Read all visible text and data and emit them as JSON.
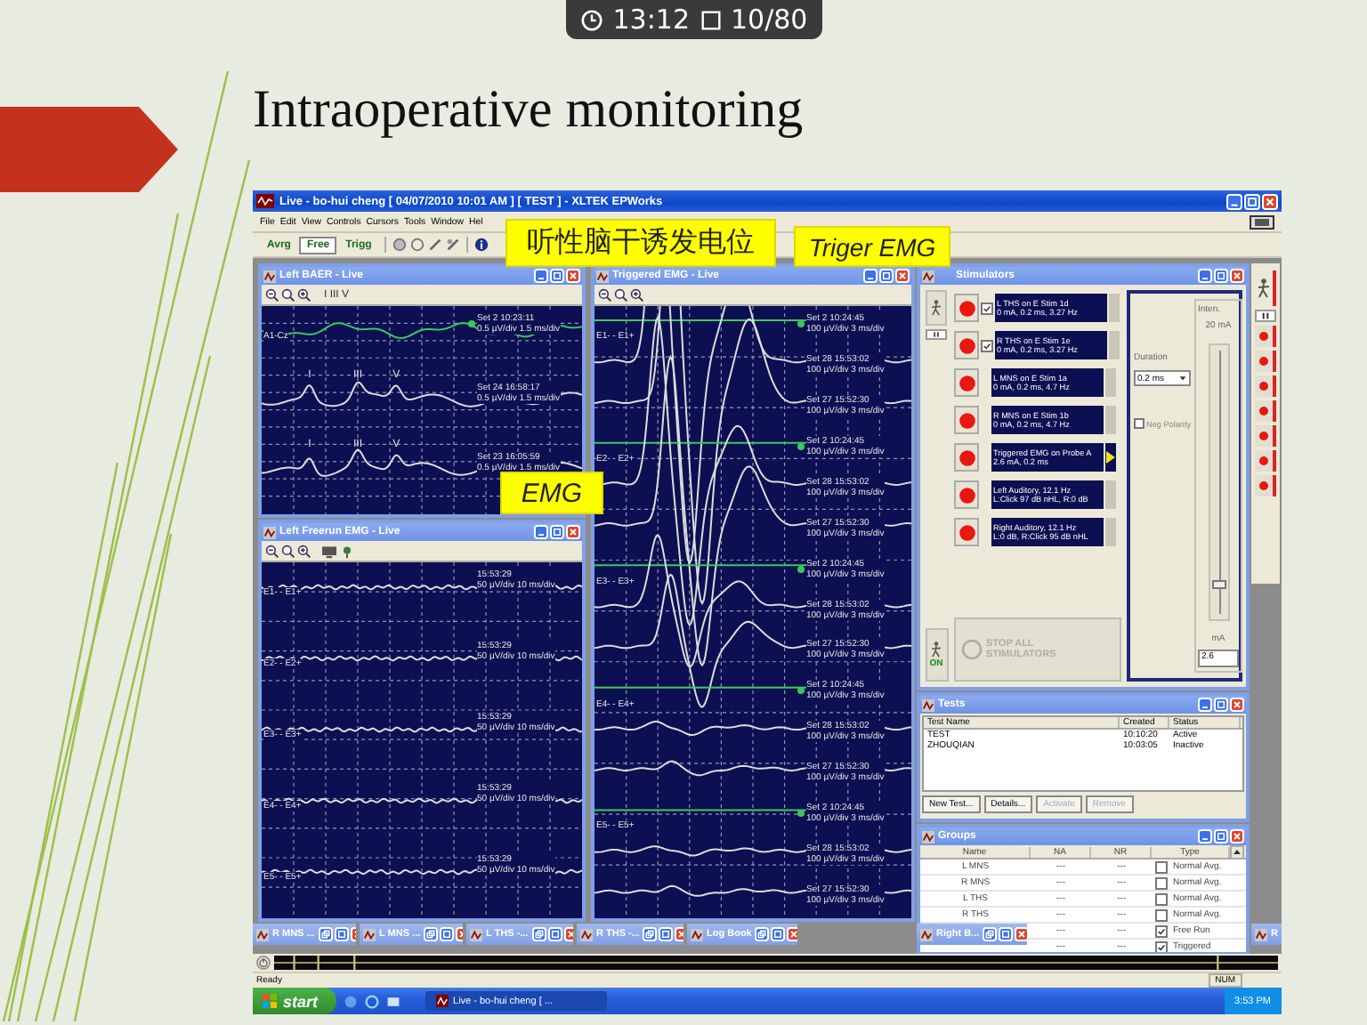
{
  "viewer": {
    "time": "13:12",
    "page": "10/80"
  },
  "slide": {
    "title": "Intraoperative monitoring",
    "callouts": [
      {
        "text": "听性脑干诱发电位"
      },
      {
        "text": "Triger EMG"
      },
      {
        "text": "EMG"
      }
    ]
  },
  "app": {
    "title": "Live - bo-hui cheng  [ 04/07/2010 10:01 AM ]  [ TEST ]  - XLTEK EPWorks",
    "menu": [
      "File",
      "Edit",
      "View",
      "Controls",
      "Cursors",
      "Tools",
      "Window",
      "Hel"
    ],
    "modes": [
      {
        "label": "Avrg",
        "selected": false
      },
      {
        "label": "Free",
        "selected": true
      },
      {
        "label": "Trigg",
        "selected": false
      }
    ],
    "windows": [
      {
        "kind": "baer",
        "title": "Left BAER - Live",
        "marks": "I  III  V",
        "channels": [
          {
            "label": "A1-Cz",
            "sweeps": [
              {
                "set": "Set 2 10:23:11",
                "scale": "0.5 µV/div 1.5 ms/div",
                "marker": true
              },
              {
                "set": "Set 24 16:58:17",
                "scale": "0.5 µV/div 1.5 ms/div",
                "marker": false,
                "peaks": [
                  "I",
                  "III",
                  "V"
                ]
              },
              {
                "set": "Set 23 16:05:59",
                "scale": "0.5 µV/div 1.5 ms/div",
                "marker": false,
                "peaks": [
                  "I",
                  "III",
                  "V"
                ]
              }
            ]
          }
        ]
      },
      {
        "kind": "freerun",
        "title": "Left Freerun EMG - Live",
        "channels": [
          {
            "label": "E1- - E1+",
            "sweeps": [
              {
                "set": "15:53:29",
                "scale": "50 µV/div 10 ms/div",
                "marker": false
              }
            ]
          },
          {
            "label": "E2- - E2+",
            "sweeps": [
              {
                "set": "15:53:29",
                "scale": "50 µV/div 10 ms/div",
                "marker": false
              }
            ]
          },
          {
            "label": "E3- - E3+",
            "sweeps": [
              {
                "set": "15:53:29",
                "scale": "50 µV/div 10 ms/div",
                "marker": false
              }
            ]
          },
          {
            "label": "E4- - E4+",
            "sweeps": [
              {
                "set": "15:53:29",
                "scale": "50 µV/div 10 ms/div",
                "marker": false
              }
            ]
          },
          {
            "label": "E5- - E5+",
            "sweeps": [
              {
                "set": "15:53:29",
                "scale": "50 µV/div 10 ms/div",
                "marker": false
              }
            ]
          }
        ]
      },
      {
        "kind": "triggered",
        "title": "Triggered EMG - Live",
        "channels": [
          {
            "label": "E1- - E1+",
            "sweeps": [
              {
                "set": "Set 2 10:24:45",
                "scale": "100 µV/div 3 ms/div",
                "marker": true
              },
              {
                "set": "Set 28 15:53:02",
                "scale": "100 µV/div 3 ms/div",
                "marker": false
              },
              {
                "set": "Set 27 15:52:30",
                "scale": "100 µV/div 3 ms/div",
                "marker": false
              }
            ]
          },
          {
            "label": "E2- - E2+",
            "sweeps": [
              {
                "set": "Set 2 10:24:45",
                "scale": "100 µV/div 3 ms/div",
                "marker": true
              },
              {
                "set": "Set 28 15:53:02",
                "scale": "100 µV/div 3 ms/div",
                "marker": false
              },
              {
                "set": "Set 27 15:52:30",
                "scale": "100 µV/div 3 ms/div",
                "marker": false
              }
            ]
          },
          {
            "label": "E3- - E3+",
            "sweeps": [
              {
                "set": "Set 2 10:24:45",
                "scale": "100 µV/div 3 ms/div",
                "marker": true
              },
              {
                "set": "Set 28 15:53:02",
                "scale": "100 µV/div 3 ms/div",
                "marker": false
              },
              {
                "set": "Set 27 15:52:30",
                "scale": "100 µV/div 3 ms/div",
                "marker": false
              }
            ]
          },
          {
            "label": "E4- - E4+",
            "sweeps": [
              {
                "set": "Set 2 10:24:45",
                "scale": "100 µV/div 3 ms/div",
                "marker": true
              },
              {
                "set": "Set 28 15:53:02",
                "scale": "100 µV/div 3 ms/div",
                "marker": false
              },
              {
                "set": "Set 27 15:52:30",
                "scale": "100 µV/div 3 ms/div",
                "marker": false
              }
            ]
          },
          {
            "label": "E5- - E5+",
            "sweeps": [
              {
                "set": "Set 2 10:24:45",
                "scale": "100 µV/div 3 ms/div",
                "marker": true
              },
              {
                "set": "Set 28 15:53:02",
                "scale": "100 µV/div 3 ms/div",
                "marker": false
              },
              {
                "set": "Set 27 15:52:30",
                "scale": "100 µV/div 3 ms/div",
                "marker": false
              }
            ]
          }
        ]
      },
      {
        "kind": "stimulators",
        "title": "Stimulators",
        "stimulators": [
          {
            "kind": "checkable",
            "checked": true,
            "selected": false,
            "name": "L THS on E Stim 1d",
            "settings": "0 mA, 0.2 ms, 3.27 Hz"
          },
          {
            "kind": "checkable",
            "checked": true,
            "selected": false,
            "name": "R THS on E Stim 1e",
            "settings": "0 mA, 0.2 ms, 3.27 Hz"
          },
          {
            "kind": "plain",
            "selected": false,
            "name": "L MNS on E Stim 1a",
            "settings": "0 mA, 0.2 ms, 4.7 Hz"
          },
          {
            "kind": "plain",
            "selected": false,
            "name": "R MNS on E Stim 1b",
            "settings": "0 mA, 0.2 ms, 4.7 Hz"
          },
          {
            "kind": "plain",
            "selected": true,
            "name": "Triggered EMG on Probe A",
            "settings": "2.6 mA, 0.2 ms"
          },
          {
            "kind": "plain",
            "selected": false,
            "name": "Left Auditory, 12.1 Hz",
            "settings": "L:Click 97 dB nHL, R:0 dB"
          },
          {
            "kind": "plain",
            "selected": false,
            "name": "Right Auditory, 12.1 Hz",
            "settings": "L:0 dB, R:Click 95 dB nHL"
          }
        ],
        "on": "ON",
        "stop": "STOP ALL STIMULATORS",
        "duration_label": "Duration",
        "duration": "0.2 ms",
        "polarity": {
          "label": "Neg Polarity",
          "checked": false,
          "disabled": true
        },
        "intensity_label": "Inten.",
        "max": "20 mA",
        "intensity": {
          "level": 0.13
        },
        "unit": "mA",
        "value": "2.6"
      },
      {
        "kind": "tests",
        "title": "Tests",
        "columns": [
          "Test Name",
          "Created",
          "Status"
        ],
        "rows": [
          [
            "TEST",
            "10:10:20",
            "Active"
          ],
          [
            "ZHOUQIAN",
            "10:03:05",
            "Inactive"
          ]
        ],
        "buttons": [
          {
            "label": "New Test...",
            "disabled": false
          },
          {
            "label": "Details...",
            "disabled": false
          },
          {
            "label": "Activate",
            "disabled": true
          },
          {
            "label": "Remove",
            "disabled": true
          }
        ]
      },
      {
        "kind": "groups",
        "title": "Groups",
        "columns": [
          "Name",
          "NA",
          "NR",
          "Type"
        ],
        "rows": [
          {
            "name": "L MNS",
            "na": "---",
            "nr": "---",
            "checked": false,
            "type": "Normal Avg."
          },
          {
            "name": "R MNS",
            "na": "---",
            "nr": "---",
            "checked": false,
            "type": "Normal Avg."
          },
          {
            "name": "L THS",
            "na": "---",
            "nr": "---",
            "checked": false,
            "type": "Normal Avg."
          },
          {
            "name": "R THS",
            "na": "---",
            "nr": "---",
            "checked": false,
            "type": "Normal Avg."
          },
          {
            "na": "---",
            "nr": "---",
            "checked": true,
            "type": "Free Run"
          },
          {
            "na": "---",
            "nr": "---",
            "checked": true,
            "type": "Triggered"
          }
        ]
      }
    ],
    "minimized": [
      {
        "title": "R MNS ..."
      },
      {
        "title": "L MNS ..."
      },
      {
        "title": "L THS -..."
      },
      {
        "title": "R THS -..."
      },
      {
        "title": "Log Book"
      },
      {
        "title": "Right B..."
      },
      {
        "title": "R"
      }
    ],
    "status": "Ready",
    "indicator": "NUM",
    "taskbar": {
      "start": "start",
      "task": "Live - bo-hui cheng [ ...",
      "clock": "3:53 PM"
    }
  }
}
